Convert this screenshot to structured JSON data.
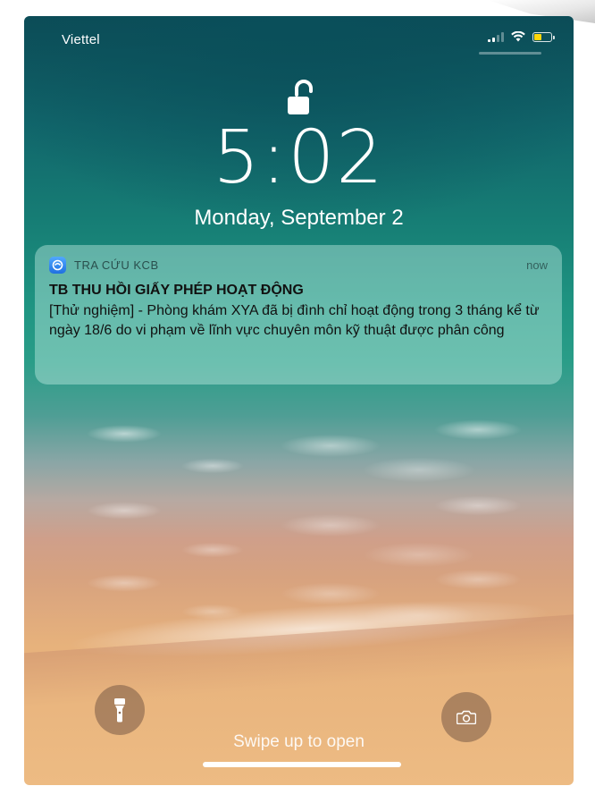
{
  "status_bar": {
    "carrier": "Viettel",
    "battery_level": 0.45,
    "battery_color": "#ffd60a"
  },
  "lock": {
    "icon": "unlocked-padlock-icon"
  },
  "clock": {
    "time": "5:02",
    "date": "Monday, September 2"
  },
  "notification": {
    "app_name": "TRA CỨU KCB",
    "app_icon": "app-icon",
    "time": "now",
    "title": "TB THU HỒI GIẤY PHÉP HOẠT ĐỘNG",
    "body": "[Thử nghiệm] - Phòng khám XYA đã bị đình chỉ hoạt động trong 3 tháng kể từ ngày 18/6 do vi phạm về lĩnh vực chuyên môn kỹ thuật được phân công"
  },
  "bottom": {
    "flashlight_icon": "flashlight-icon",
    "camera_icon": "camera-icon",
    "swipe_text": "Swipe up to open"
  }
}
